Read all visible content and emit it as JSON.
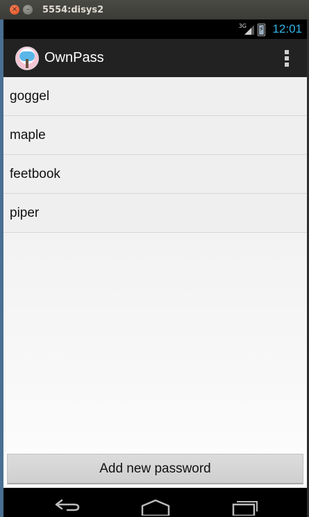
{
  "window": {
    "title": "5554:disys2",
    "close_symbol": "×",
    "minimize_symbol": "–"
  },
  "status_bar": {
    "network": "3G",
    "time": "12:01"
  },
  "action_bar": {
    "title": "OwnPass",
    "app_icon": "cloud-tree-icon",
    "overflow_icon": "overflow-menu-icon"
  },
  "password_list": [
    {
      "label": "goggel"
    },
    {
      "label": "maple"
    },
    {
      "label": "feetbook"
    },
    {
      "label": "piper"
    }
  ],
  "add_button": {
    "label": "Add new password"
  },
  "nav_bar": {
    "icons": [
      "back-icon",
      "home-icon",
      "recent-apps-icon"
    ]
  },
  "colors": {
    "clock": "#33b5e5",
    "action_bar": "#222222",
    "status_bar": "#000000"
  }
}
